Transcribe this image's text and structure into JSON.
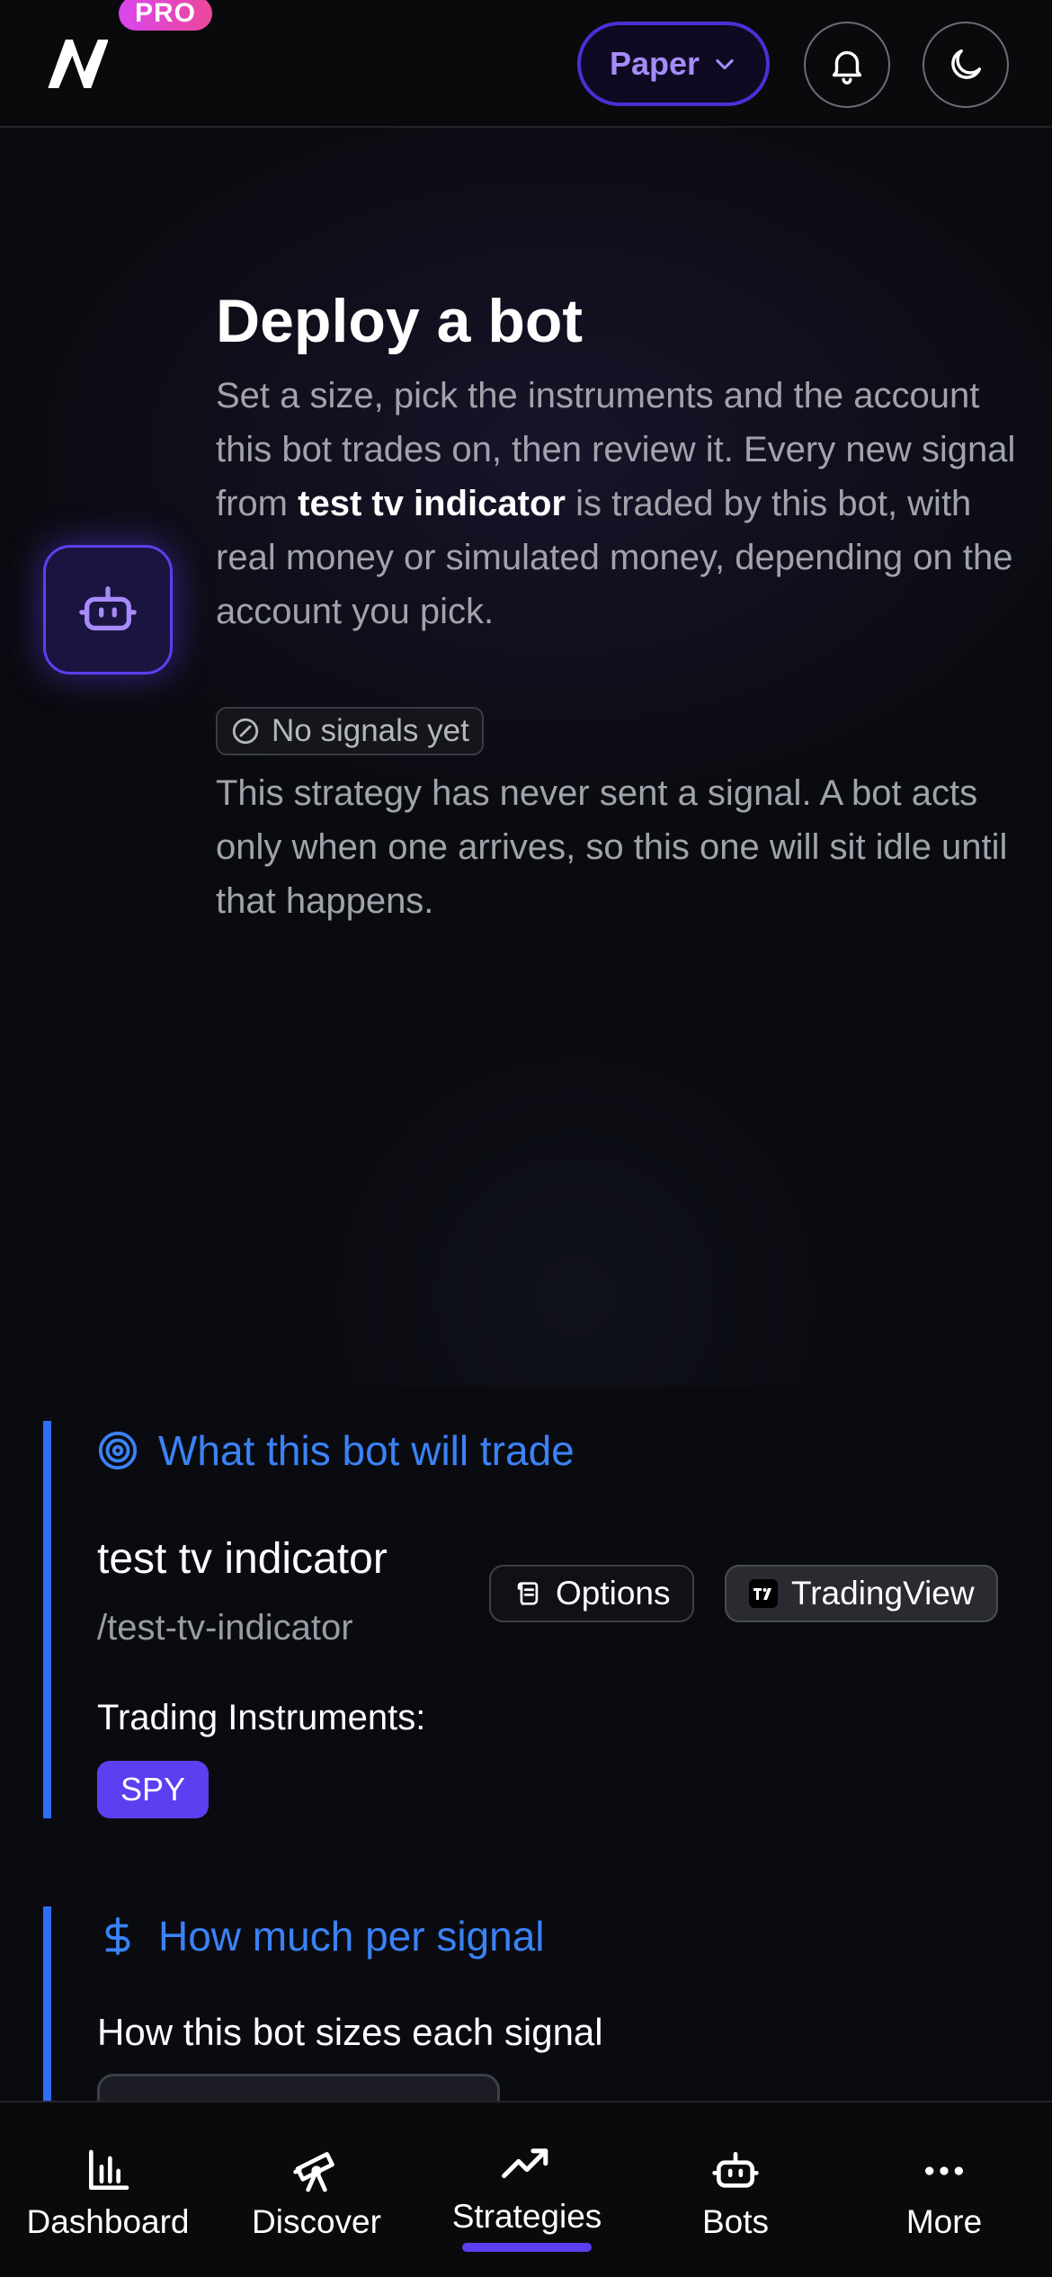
{
  "header": {
    "pro_badge": "PRO",
    "account_mode": "Paper"
  },
  "hero": {
    "title": "Deploy a bot",
    "desc_part1": "Set a size, pick the instruments and the account this bot trades on, then review it. Every new signal from ",
    "strategy_name": "test tv indicator",
    "desc_part2": " is traded by this bot, with real money or simulated money, depending on the account you pick.",
    "signal_status": "No signals yet",
    "signal_note": "This strategy has never sent a signal. A bot acts only when one arrives, so this one will sit idle until that happens."
  },
  "trade_section": {
    "title": "What this bot will trade",
    "strategy_name": "test tv indicator",
    "strategy_slug": "/test-tv-indicator",
    "chip_options": "Options",
    "chip_tradingview": "TradingView",
    "instruments_label": "Trading Instruments:",
    "instruments": [
      "SPY"
    ]
  },
  "sizing_section": {
    "title": "How much per signal",
    "label": "How this bot sizes each signal"
  },
  "bottom_nav": {
    "items": [
      {
        "label": "Dashboard",
        "icon": "bar-chart-icon"
      },
      {
        "label": "Discover",
        "icon": "telescope-icon"
      },
      {
        "label": "Strategies",
        "icon": "trending-up-icon"
      },
      {
        "label": "Bots",
        "icon": "bot-icon"
      },
      {
        "label": "More",
        "icon": "more-dots-icon"
      }
    ],
    "active": "Strategies"
  },
  "colors": {
    "accent": "#5b3ff0",
    "section_blue": "#2f6df6",
    "pro_pink": "#ec4899"
  }
}
